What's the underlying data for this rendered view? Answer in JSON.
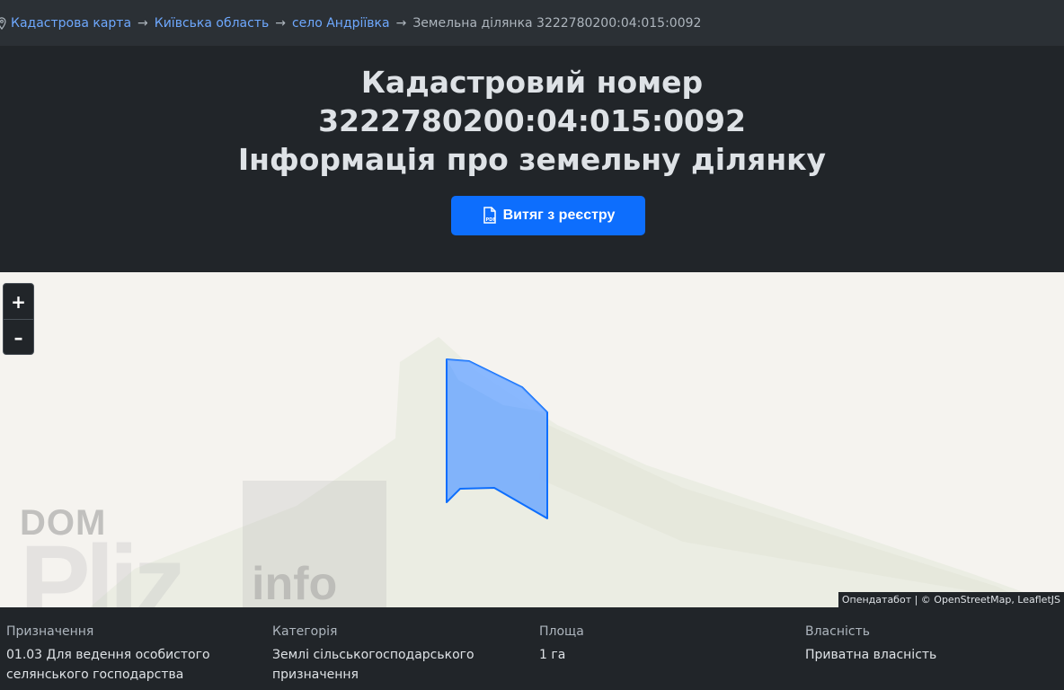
{
  "breadcrumb": {
    "items": [
      "Кадастрова карта",
      "Київська область",
      "село Андріївка"
    ],
    "separator": "→",
    "current": "Земельна ділянка 3222780200:04:015:0092"
  },
  "header": {
    "title_line1": "Кадастровий номер",
    "title_line2": "3222780200:04:015:0092",
    "title_line3": "Інформація про земельну ділянку",
    "extract_button": "Витяг з реєстру",
    "extract_icon": "pdf-file-icon"
  },
  "map": {
    "zoom_in": "+",
    "zoom_out": "–",
    "attribution": "Опендатабот | © OpenStreetMap, LeafletJS",
    "parcel_color": "#6ea8fe"
  },
  "watermark": {
    "line1": "DOM",
    "line2": "Pliz",
    "line3": "info"
  },
  "info": [
    {
      "label": "Призначення",
      "value": "01.03 Для ведення особистого селянського господарства"
    },
    {
      "label": "Категорія",
      "value": "Землі сільськогосподарського призначення"
    },
    {
      "label": "Площа",
      "value": "1 га"
    },
    {
      "label": "Власність",
      "value": "Приватна власність"
    }
  ]
}
